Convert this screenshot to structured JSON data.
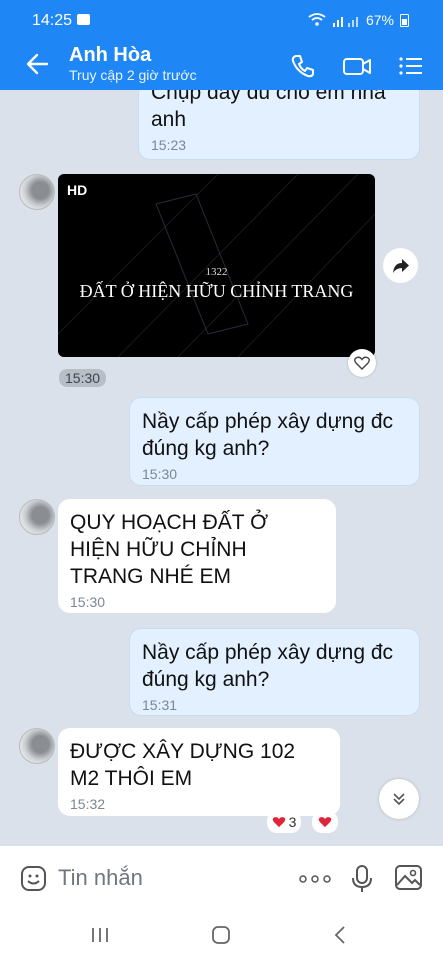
{
  "status_bar": {
    "time": "14:25",
    "battery": "67%"
  },
  "header": {
    "contact_name": "Anh Hòa",
    "last_seen": "Truy cập 2 giờ trước"
  },
  "messages": [
    {
      "from": "me",
      "text": "Chụp đầy đủ cho em nha anh",
      "time": "15:23"
    },
    {
      "from": "other",
      "type": "video",
      "badge": "HD",
      "caption_code": "1322",
      "caption_title": "ĐẤT Ở HIỆN HỮU CHỈNH TRANG",
      "time": "15:30"
    },
    {
      "from": "me",
      "text": "Nầy cấp phép xây dựng đc đúng kg anh?",
      "time": "15:30"
    },
    {
      "from": "other",
      "text": "QUY HOẠCH ĐẤT Ở HIỆN HỮU CHỈNH TRANG NHÉ EM",
      "time": "15:30"
    },
    {
      "from": "me",
      "text": "Nầy cấp phép xây dựng đc đúng kg anh?",
      "time": "15:31"
    },
    {
      "from": "other",
      "text": "ĐƯỢC XÂY DỰNG 102 M2 THÔI EM",
      "time": "15:32",
      "reaction_count": "3"
    }
  ],
  "input": {
    "placeholder": "Tin nhắn"
  },
  "colors": {
    "header_blue": "#1e86f5",
    "my_bubble": "#e2f0ff",
    "chat_bg": "#dbe1ea",
    "heart": "#e0243a"
  }
}
